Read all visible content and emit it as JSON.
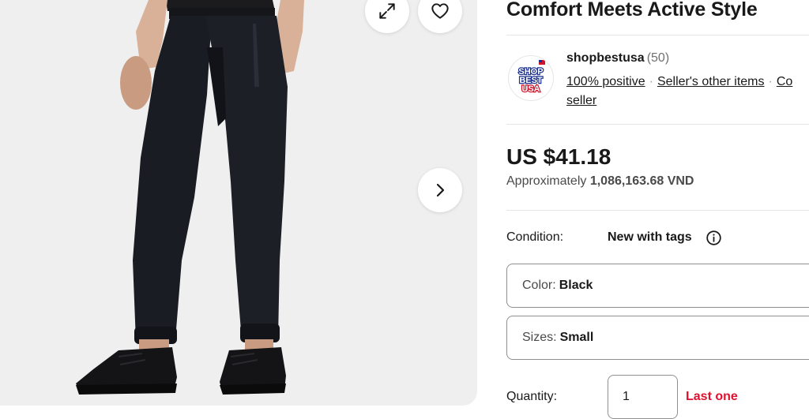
{
  "product": {
    "title": "Comfort Meets Active Style",
    "image_alt": "man wearing black jogger pants and black sneakers"
  },
  "gallery": {
    "expand_icon": "expand-arrows-icon",
    "wishlist_icon": "heart-outline-icon",
    "next_icon": "chevron-right-icon"
  },
  "seller": {
    "name": "shopbestusa",
    "feedback_count": "(50)",
    "logo_text": [
      "SHOP",
      "BEST",
      "USA"
    ],
    "positive": "100% positive",
    "other_items": "Seller's other items",
    "contact": "Contact seller",
    "contact_line1": "Co",
    "contact_line2": "seller"
  },
  "pricing": {
    "price": "US $41.18",
    "approx_label": "Approximately",
    "approx_value": "1,086,163.68 VND"
  },
  "condition": {
    "label": "Condition:",
    "value": "New with tags",
    "info_icon": "info-circle-icon"
  },
  "variations": {
    "color": {
      "label": "Color:",
      "value": "Black"
    },
    "size": {
      "label": "Sizes:",
      "value": "Small"
    }
  },
  "quantity": {
    "label": "Quantity:",
    "value": "1",
    "availability": "Last one"
  },
  "colors": {
    "accent_red": "#e0102e",
    "link": "#191919",
    "gallery_bg": "#efefef"
  }
}
